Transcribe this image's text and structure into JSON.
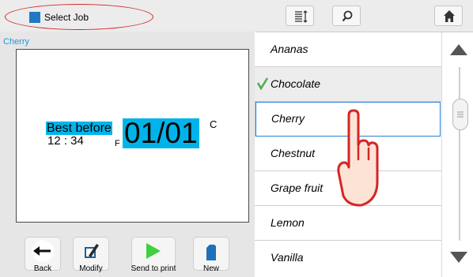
{
  "toolbar": {
    "select_job_label": "Select Job",
    "select_job_icon": "blue-square-icon",
    "list_icon": "list-sort-icon",
    "search_icon": "search-icon",
    "home_icon": "home-icon",
    "highlight_color": "#d42626"
  },
  "preview": {
    "job_name": "Cherry",
    "best_before": "Best before",
    "time": "12 : 34",
    "f_marker": "F",
    "date": "01/01",
    "c_marker": "C",
    "highlight_color": "#00b4ea"
  },
  "actions": [
    {
      "label": "Back",
      "icon": "arrow-left-icon"
    },
    {
      "label": "Modify",
      "icon": "edit-icon"
    },
    {
      "label": "Send to print",
      "icon": "play-icon"
    },
    {
      "label": "New",
      "icon": "new-document-icon"
    }
  ],
  "job_list": {
    "items": [
      {
        "label": "Ananas"
      },
      {
        "label": "Chocolate",
        "current": true,
        "icon": "checkmark-icon"
      },
      {
        "label": "Cherry",
        "selected": true
      },
      {
        "label": "Chestnut"
      },
      {
        "label": "Grape fruit"
      },
      {
        "label": "Lemon"
      },
      {
        "label": "Vanilla"
      }
    ],
    "selection_color": "#2b7fd4"
  },
  "scrollbar": {
    "up_icon": "triangle-up-icon",
    "down_icon": "triangle-down-icon"
  },
  "cursor": {
    "icon": "hand-pointer-icon",
    "color": "#d42626"
  }
}
